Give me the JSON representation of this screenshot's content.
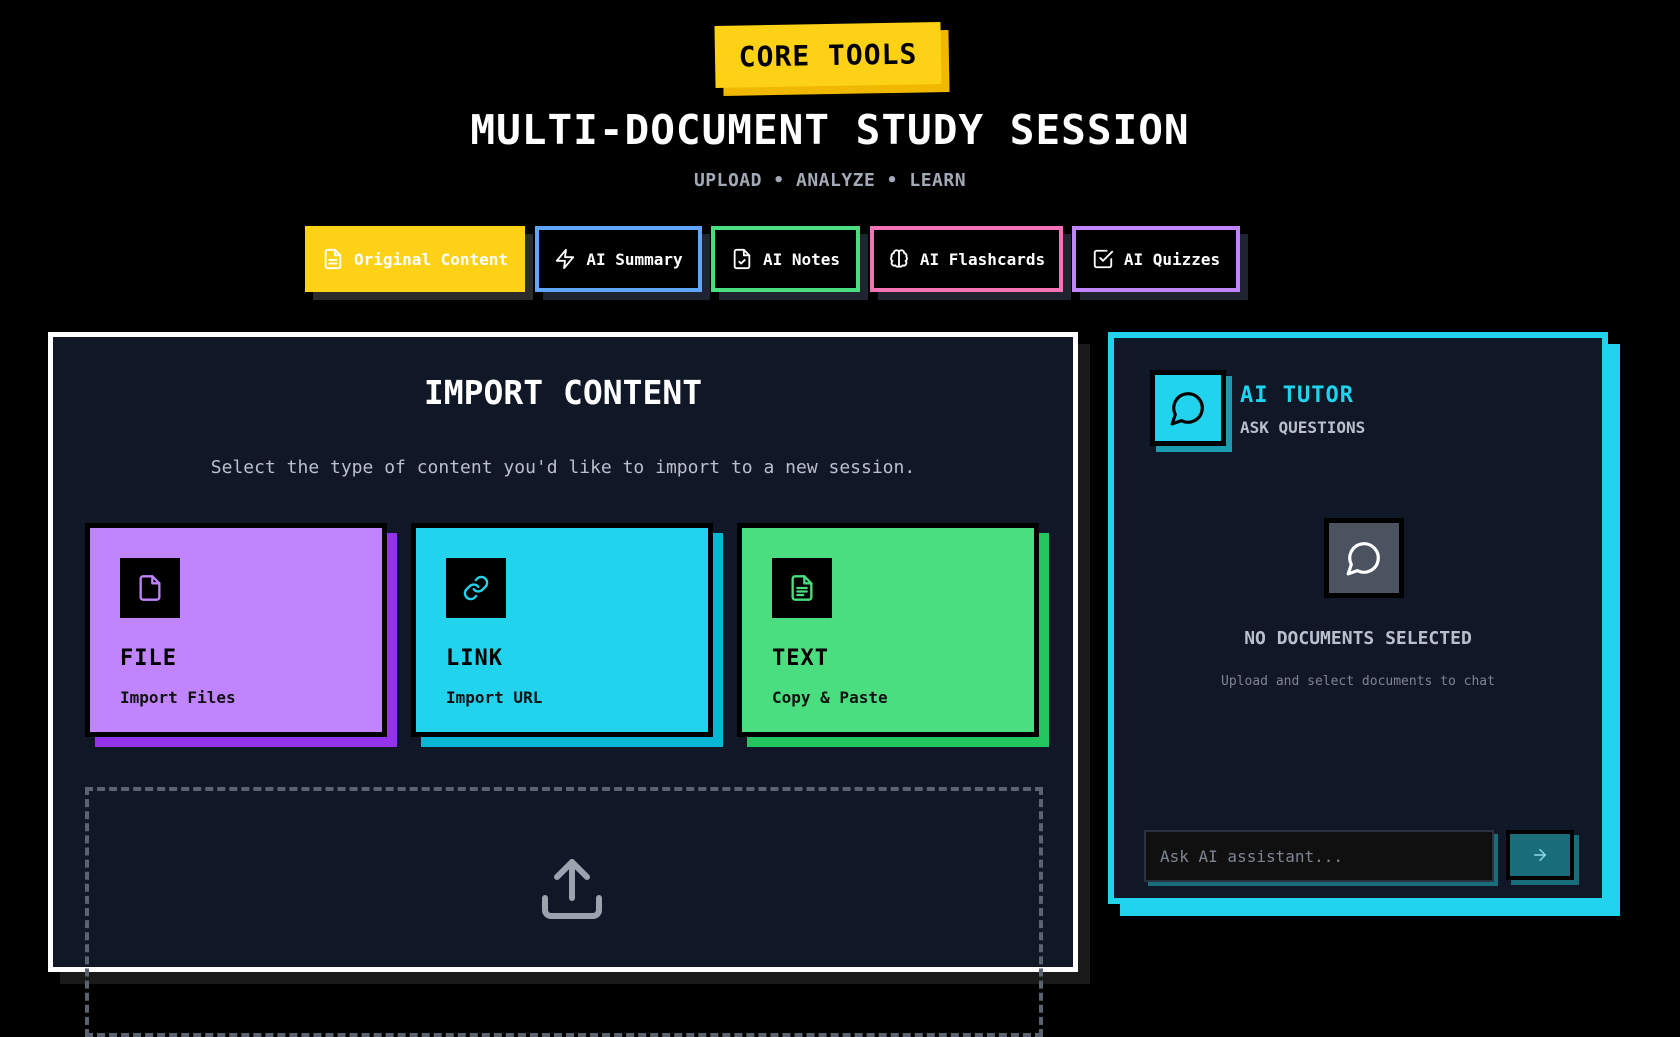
{
  "header": {
    "badge": "CORE TOOLS",
    "title": "MULTI-DOCUMENT STUDY SESSION",
    "subtitle": "UPLOAD • ANALYZE • LEARN"
  },
  "tabs": [
    {
      "label": "Original Content",
      "icon": "document-icon",
      "color": "#fcd116",
      "active": true
    },
    {
      "label": "AI Summary",
      "icon": "lightning-icon",
      "color": "#60a5fa"
    },
    {
      "label": "AI Notes",
      "icon": "document-check-icon",
      "color": "#4ade80"
    },
    {
      "label": "AI Flashcards",
      "icon": "brain-icon",
      "color": "#f472b6"
    },
    {
      "label": "AI Quizzes",
      "icon": "checkbox-icon",
      "color": "#c084fc"
    }
  ],
  "import": {
    "title": "IMPORT CONTENT",
    "description": "Select the type of content you'd like to import to a new session.",
    "cards": [
      {
        "title": "FILE",
        "subtitle": "Import Files",
        "icon": "file-icon",
        "color": "#c084fc"
      },
      {
        "title": "LINK",
        "subtitle": "Import URL",
        "icon": "link-icon",
        "color": "#22d3ee"
      },
      {
        "title": "TEXT",
        "subtitle": "Copy & Paste",
        "icon": "text-document-icon",
        "color": "#4ade80"
      }
    ],
    "dropzone_icon": "upload-icon"
  },
  "tutor": {
    "title": "AI TUTOR",
    "subtitle": "ASK QUESTIONS",
    "empty_title": "NO DOCUMENTS SELECTED",
    "empty_subtitle": "Upload and select documents to chat",
    "input_placeholder": "Ask AI assistant...",
    "accent": "#22d3ee"
  }
}
